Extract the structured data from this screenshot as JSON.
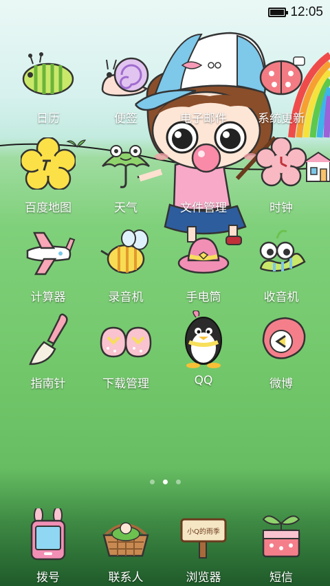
{
  "status_bar": {
    "time": "12:05",
    "battery_icon": "battery-full-icon"
  },
  "apps": [
    {
      "label": "日历",
      "icon": "calendar-caterpillar-icon"
    },
    {
      "label": "便签",
      "icon": "notes-snail-icon"
    },
    {
      "label": "电子邮件",
      "icon": "email-icon"
    },
    {
      "label": "系统更新",
      "icon": "system-update-ladybug-icon"
    },
    {
      "label": "百度地图",
      "icon": "map-flower-icon"
    },
    {
      "label": "天气",
      "icon": "weather-frog-umbrella-icon"
    },
    {
      "label": "文件管理",
      "icon": "file-manager-icon"
    },
    {
      "label": "时钟",
      "icon": "clock-flower-icon"
    },
    {
      "label": "计算器",
      "icon": "calculator-airplane-icon"
    },
    {
      "label": "录音机",
      "icon": "recorder-bee-icon"
    },
    {
      "label": "手电筒",
      "icon": "flashlight-hat-icon"
    },
    {
      "label": "收音机",
      "icon": "radio-snail-icon"
    },
    {
      "label": "指南针",
      "icon": "compass-shovel-icon"
    },
    {
      "label": "下载管理",
      "icon": "download-shoes-icon"
    },
    {
      "label": "QQ",
      "icon": "qq-penguin-icon"
    },
    {
      "label": "微博",
      "icon": "weibo-shell-icon"
    }
  ],
  "pagination": {
    "pages": 3,
    "current": 2
  },
  "dock": [
    {
      "label": "拨号",
      "icon": "phone-bunny-icon"
    },
    {
      "label": "联系人",
      "icon": "contacts-basket-icon"
    },
    {
      "label": "浏览器",
      "icon": "browser-sign-icon",
      "sign_text": "小Q的雨季"
    },
    {
      "label": "短信",
      "icon": "sms-sprout-icon"
    }
  ],
  "colors": {
    "sky": "#d6f1ee",
    "grass": "#74c86c",
    "dock_dark": "#1f5a2a"
  }
}
